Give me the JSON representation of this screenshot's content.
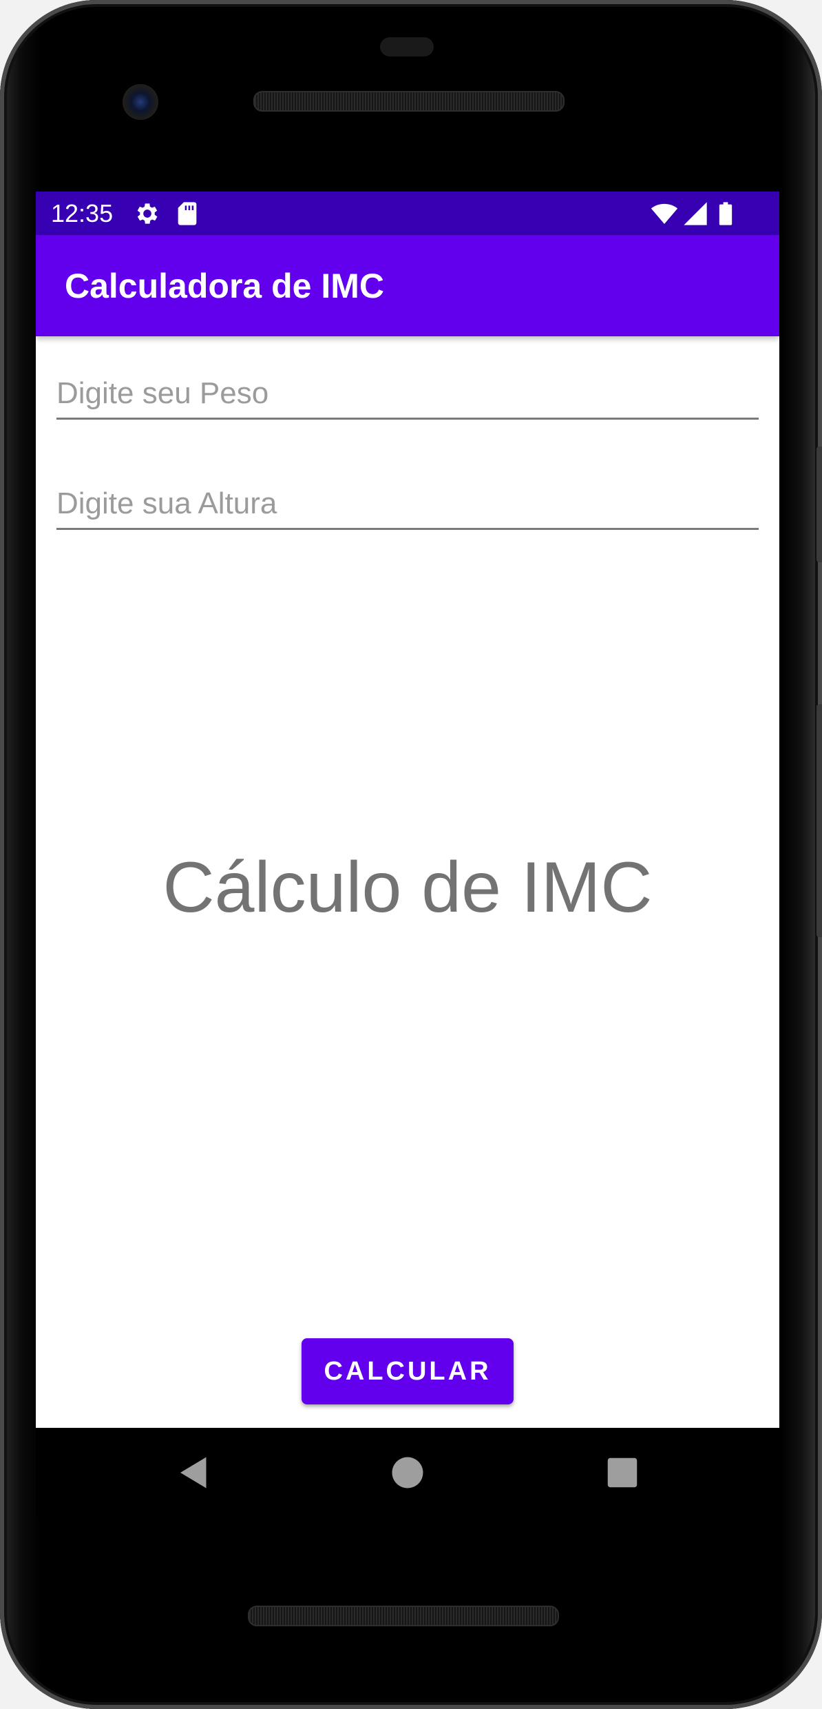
{
  "status_bar": {
    "time": "12:35",
    "icons": [
      "gear-icon",
      "sd-card-icon",
      "wifi-icon",
      "signal-icon",
      "battery-icon"
    ]
  },
  "app_bar": {
    "title": "Calculadora de IMC"
  },
  "form": {
    "peso_placeholder": "Digite seu Peso",
    "peso_value": "",
    "altura_placeholder": "Digite sua Altura",
    "altura_value": ""
  },
  "result": {
    "text": "Cálculo de IMC"
  },
  "actions": {
    "calculate_label": "CALCULAR"
  },
  "nav_bar": {
    "icons": [
      "back-icon",
      "home-icon",
      "recents-icon"
    ]
  },
  "colors": {
    "primary": "#6200ee",
    "primary_dark": "#3700b3",
    "result_text": "#737373",
    "hint_text": "#9b9b9b"
  }
}
